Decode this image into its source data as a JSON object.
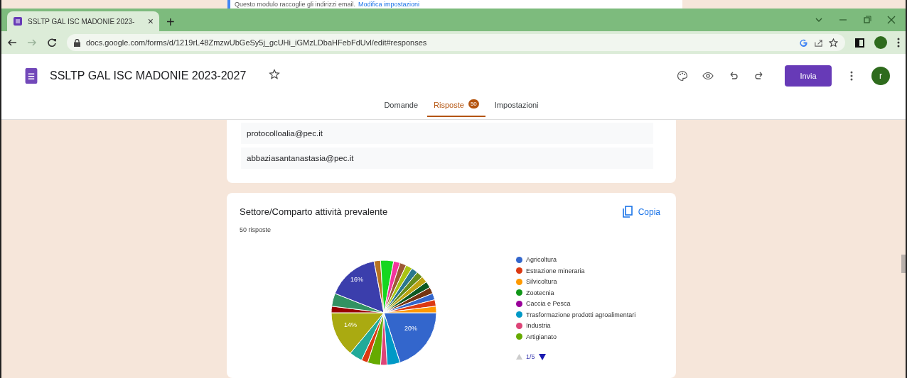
{
  "background_page": {
    "notice": "Questo modulo raccoglie gli indirizzi email.",
    "link": "Modifica impostazioni"
  },
  "browser": {
    "tab_title": "SSLTP GAL ISC MADONIE 2023-",
    "tab_close": "×",
    "new_tab": "+",
    "url": "docs.google.com/forms/d/1219rL48ZmzwUbGeSy5j_gcUHi_iGMzLDbaHFebFdUvl/edit#responses"
  },
  "form": {
    "title": "SSLTP GAL ISC MADONIE 2023-2027",
    "send": "Invia",
    "avatar": "r",
    "tabs": [
      {
        "label": "Domande",
        "selected": false
      },
      {
        "label": "Risposte",
        "selected": true,
        "badge": "50"
      },
      {
        "label": "Impostazioni",
        "selected": false
      }
    ]
  },
  "email_list": [
    "protocolloalia@pec.it",
    "abbaziasantanastasia@pec.it"
  ],
  "question": {
    "title": "Settore/Comparto attività prevalente",
    "count": "50 risposte",
    "copy": "Copia",
    "slice_labels": [
      "20%",
      "16%",
      "14%"
    ],
    "legend": [
      {
        "name": "Agricoltura",
        "color": "#3366cc"
      },
      {
        "name": "Estrazione mineraria",
        "color": "#dc3912"
      },
      {
        "name": "Silvicoltura",
        "color": "#ff9900"
      },
      {
        "name": "Zootecnia",
        "color": "#109618"
      },
      {
        "name": "Caccia e Pesca",
        "color": "#990099"
      },
      {
        "name": "Trasformazione prodotti agroalimentari",
        "color": "#0099c6"
      },
      {
        "name": "Industria",
        "color": "#dd4477"
      },
      {
        "name": "Artigianato",
        "color": "#66aa00"
      }
    ],
    "pager": "1/5"
  }
}
